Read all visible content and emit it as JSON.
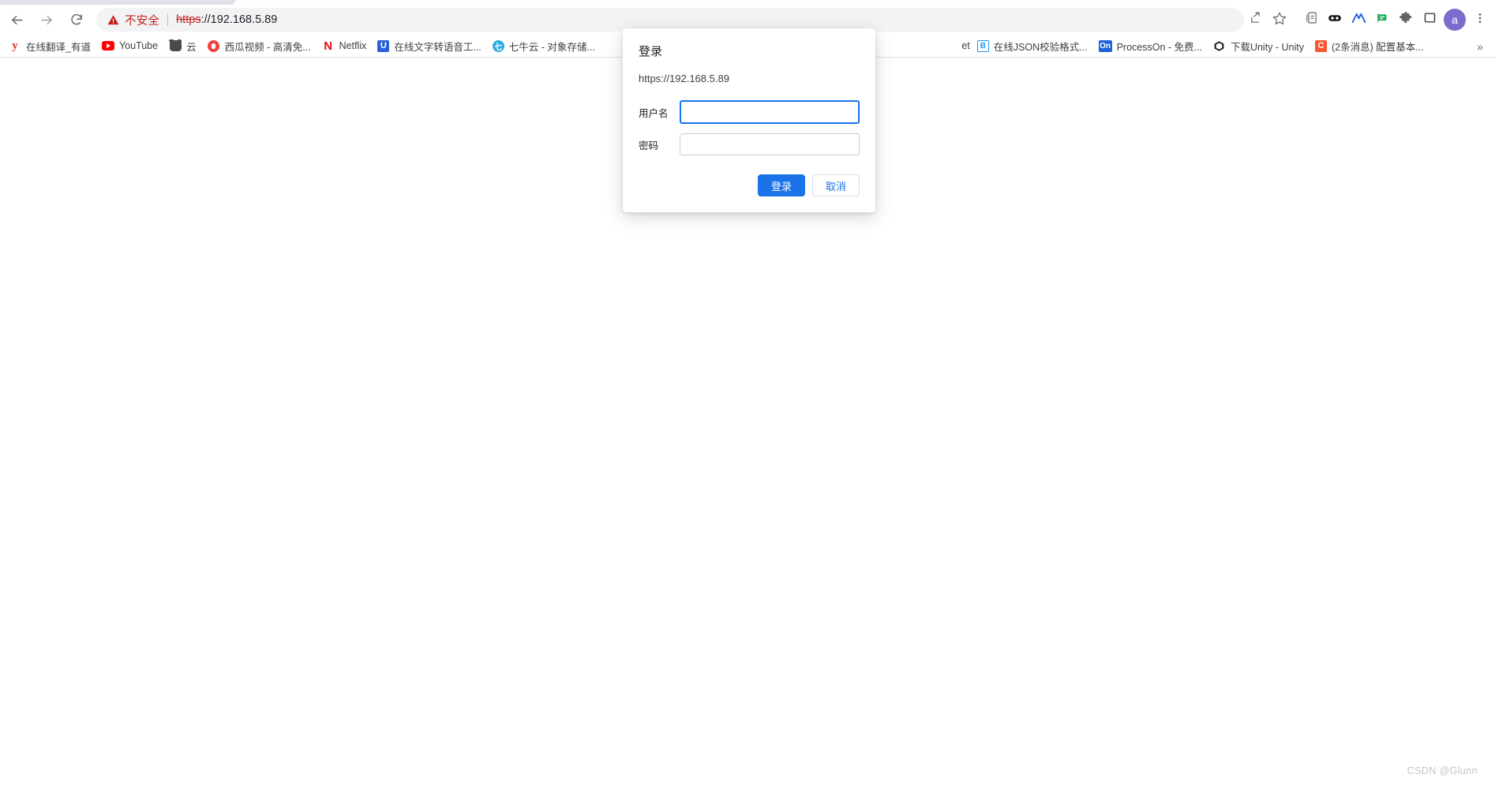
{
  "browser": {
    "navigation": {
      "back_tooltip": "后退",
      "forward_tooltip": "前进",
      "reload_tooltip": "重新加载"
    },
    "omnibox": {
      "security_label": "不安全",
      "url_scheme": "https",
      "url_rest": "://192.168.5.89",
      "full_url": "https://192.168.5.89"
    },
    "toolbar_icons": [
      {
        "name": "share-icon",
        "glyph": "share"
      },
      {
        "name": "bookmark-star-icon",
        "glyph": "star"
      },
      {
        "name": "reading-list-icon",
        "glyph": "clipboard"
      },
      {
        "name": "extension-dots-icon",
        "glyph": "dots"
      },
      {
        "name": "extension-a-icon",
        "glyph": "a-mark"
      },
      {
        "name": "extension-flag-icon",
        "glyph": "flag"
      },
      {
        "name": "extensions-puzzle-icon",
        "glyph": "puzzle"
      },
      {
        "name": "sidepanel-icon",
        "glyph": "square"
      }
    ],
    "profile": {
      "initial": "a",
      "color": "#7d6ccc"
    },
    "menu_tooltip": "自定义及控制",
    "bookmarks": [
      {
        "label": "在线翻译_有道",
        "favicon": "youdao"
      },
      {
        "label": "YouTube",
        "favicon": "youtube"
      },
      {
        "label": "云",
        "favicon": "bear"
      },
      {
        "label": "西瓜视频 - 高清免...",
        "favicon": "xigua"
      },
      {
        "label": "Netflix",
        "favicon": "netflix"
      },
      {
        "label": "在线文字转语音工...",
        "favicon": "u-blue"
      },
      {
        "label": "七牛云 - 对象存储...",
        "favicon": "qiniu"
      },
      {
        "label": "et",
        "favicon": "none"
      },
      {
        "label": "在线JSON校验格式...",
        "favicon": "json"
      },
      {
        "label": "ProcessOn - 免费...",
        "favicon": "on"
      },
      {
        "label": "下载Unity - Unity",
        "favicon": "unity"
      },
      {
        "label": "(2条消息) 配置基本...",
        "favicon": "csdn"
      }
    ],
    "bookmarks_overflow": "»"
  },
  "auth_dialog": {
    "title": "登录",
    "url": "https://192.168.5.89",
    "username": {
      "label": "用户名",
      "value": "",
      "placeholder": ""
    },
    "password": {
      "label": "密码",
      "value": "",
      "placeholder": ""
    },
    "submit_label": "登录",
    "cancel_label": "取消",
    "accent_color": "#1a73e8"
  },
  "page": {
    "watermark": "CSDN @Glunn"
  }
}
